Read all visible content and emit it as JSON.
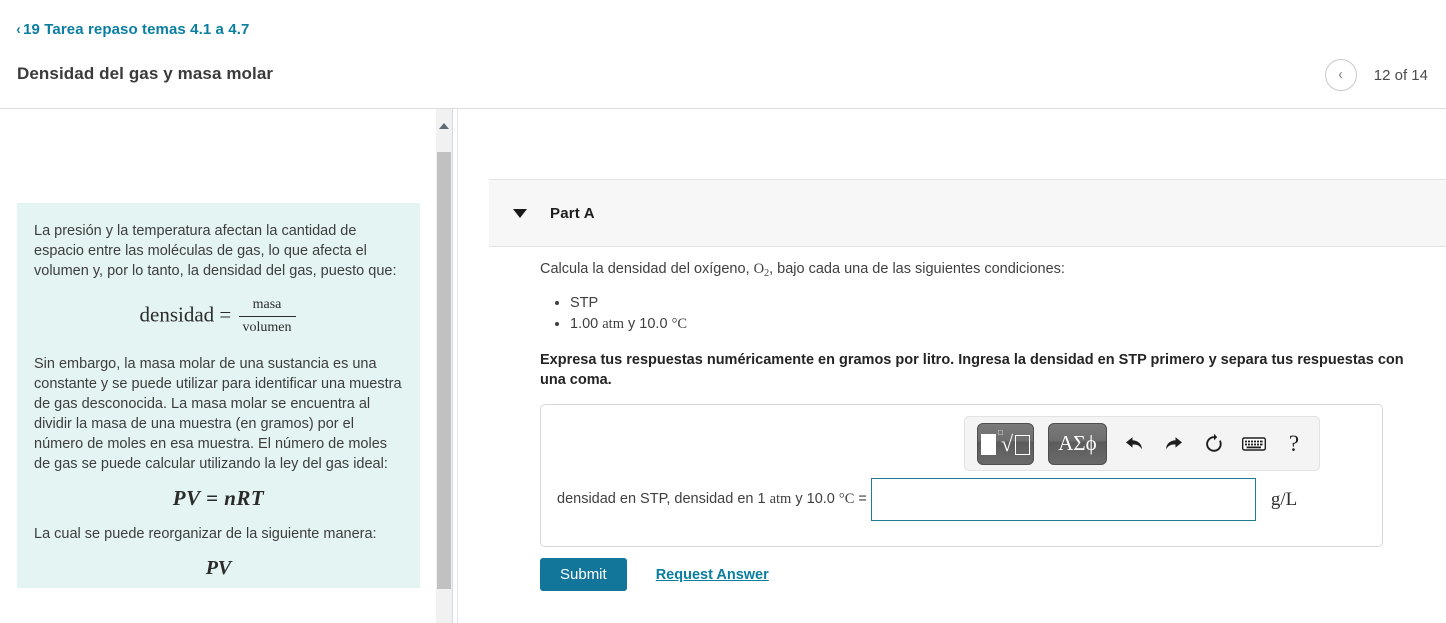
{
  "header": {
    "breadcrumb_label": "19 Tarea repaso temas 4.1 a 4.7",
    "back_icon": "‹",
    "page_title": "Densidad del gas y masa molar",
    "prev_icon": "‹",
    "pager_text": "12 of 14"
  },
  "left_panel": {
    "paragraph_1": "La presión y la temperatura afectan la cantidad de espacio entre las moléculas de gas, lo que afecta el volumen y, por lo tanto, la densidad del gas, puesto que:",
    "formula_1_lhs": "densidad =",
    "formula_1_num": "masa",
    "formula_1_den": "volumen",
    "paragraph_2": "Sin embargo, la masa molar de una sustancia es una constante y se puede utilizar para identificar una muestra de gas desconocida. La masa molar se encuentra al dividir la masa de una muestra (en gramos) por el número de moles en esa muestra. El número de moles de gas se puede calcular utilizando la ley del gas ideal:",
    "formula_2": "PV = nRT",
    "paragraph_3": "La cual se puede reorganizar de la siguiente manera:",
    "formula_3_partial": "PV"
  },
  "scrollbar": {
    "up_arrow_icon": "caret-up-icon"
  },
  "part": {
    "caret_icon": "caret-down-icon",
    "label": "Part A",
    "question_prefix": "Calcula la densidad del oxígeno, ",
    "question_formula_base": "O",
    "question_formula_sub": "2",
    "question_suffix": ", bajo cada una de las siguientes condiciones:",
    "conditions": [
      "STP",
      "1.00 atm y 10.0 °C"
    ],
    "condition_2_value": "1.00 ",
    "condition_2_unit": "atm",
    "condition_2_mid": " y 10.0 ",
    "condition_2_temp": "°C",
    "instruction_bold": "Expresa tus respuestas numéricamente en gramos por litro. Ingresa la densidad en STP primero y separa tus respuestas con una coma."
  },
  "math_toolbar": {
    "template_button_icon": "square-root-template-icon",
    "greek_button_label": "ΑΣϕ",
    "greek_button_icon": "greek-symbols-icon",
    "undo_icon": "undo-arrow-icon",
    "undo_glyph": "↶",
    "redo_icon": "redo-arrow-icon",
    "redo_glyph": "↷",
    "reset_icon": "refresh-icon",
    "reset_glyph": "↺",
    "keyboard_icon": "keyboard-icon",
    "help_icon": "question-mark-icon",
    "help_glyph": "?"
  },
  "answer": {
    "label_prefix": "densidad en STP, densidad en 1 ",
    "label_unit": "atm",
    "label_mid": " y 10.0 ",
    "label_temp": "°C",
    "label_equals": " =",
    "value": "",
    "placeholder": "",
    "unit": "g/L"
  },
  "actions": {
    "submit_label": "Submit",
    "request_answer_label": "Request Answer"
  },
  "colors": {
    "accent_teal": "#0a7ea1",
    "submit_blue": "#12769a",
    "intro_box_bg": "#e4f4f3",
    "input_border": "#1d7d94"
  }
}
